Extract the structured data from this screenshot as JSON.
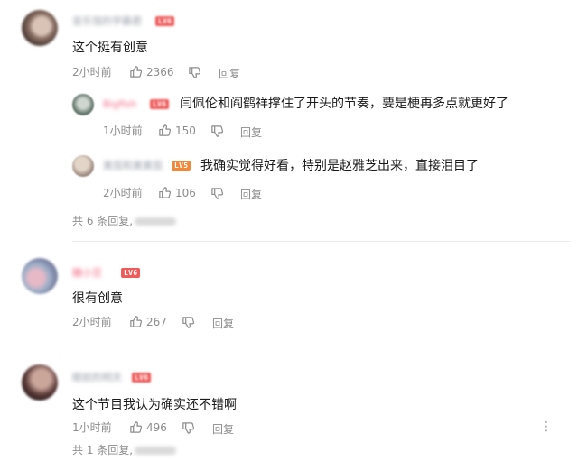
{
  "comments": [
    {
      "username": "音乐馆的学霸君",
      "level": "LV6",
      "text": "这个挺有创意",
      "time": "2小时前",
      "likes": "2366",
      "reply_label": "回复",
      "replies": [
        {
          "username": "Bigfish",
          "level": "LV6",
          "text": "闫佩伦和阎鹤祥撑住了开头的节奏，要是梗再多点就更好了",
          "time": "1小时前",
          "likes": "150",
          "reply_label": "回复"
        },
        {
          "username": "美茄和美美茄",
          "level": "LV5",
          "text": "我确实觉得好看，特别是赵雅芝出来，直接泪目了",
          "time": "2小时前",
          "likes": "106",
          "reply_label": "回复"
        }
      ],
      "more_replies": "共 6 条回复,"
    },
    {
      "username": "糖小豆",
      "level": "LV6",
      "text": "很有创意",
      "time": "2小时前",
      "likes": "267",
      "reply_label": "回复"
    },
    {
      "username": "眼前的明天",
      "level": "LV6",
      "text": "这个节目我认为确实还不错啊",
      "time": "1小时前",
      "likes": "496",
      "reply_label": "回复",
      "more_replies": "共 1 条回复,"
    }
  ],
  "icons": {
    "like": "thumbs-up-icon",
    "dislike": "thumbs-down-icon",
    "more": "more-vertical-icon"
  },
  "colors": {
    "level_red": "#ef5a5a",
    "level_orange": "#f2883a",
    "meta_gray": "#8c8c8c"
  }
}
